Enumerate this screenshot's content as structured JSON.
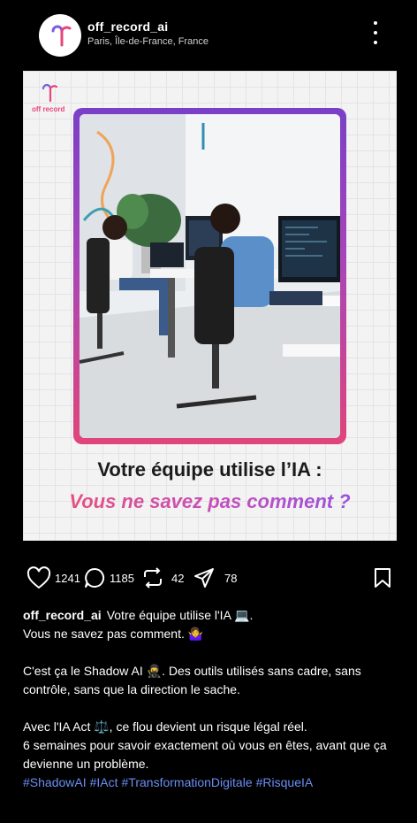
{
  "header": {
    "username": "off_record_ai",
    "location": "Paris, Île-de-France, France"
  },
  "post": {
    "brand_text": "off record",
    "headline": "Votre équipe utilise l’IA :",
    "subheadline": "Vous ne savez pas comment ?"
  },
  "actions": {
    "likes": "1241",
    "comments": "1185",
    "reposts": "42",
    "shares": "78"
  },
  "caption": {
    "username": "off_record_ai",
    "line1": "Votre équipe utilise l'IA 💻.",
    "line2": "Vous ne savez pas comment. 🤷‍♀️",
    "line3": "C'est ça le Shadow AI 🥷. Des outils utilisés sans cadre, sans contrôle, sans que la direction le sache.",
    "line4": "Avec l'IA Act ⚖️, ce flou devient un risque légal réel.",
    "line5": "6 semaines pour savoir exactement où vous en êtes, avant que ça devienne un problème.",
    "hashtags": [
      "#ShadowAI",
      "#IAct",
      "#TransformationDigitale",
      "#RisqueIA"
    ]
  },
  "colors": {
    "background": "#000000",
    "hashtag": "#6c8ef5",
    "gradient_start": "#f0506e",
    "gradient_end": "#8a54e6"
  },
  "icons": [
    "more-icon",
    "heart-icon",
    "comment-icon",
    "repost-icon",
    "share-icon",
    "bookmark-icon"
  ]
}
